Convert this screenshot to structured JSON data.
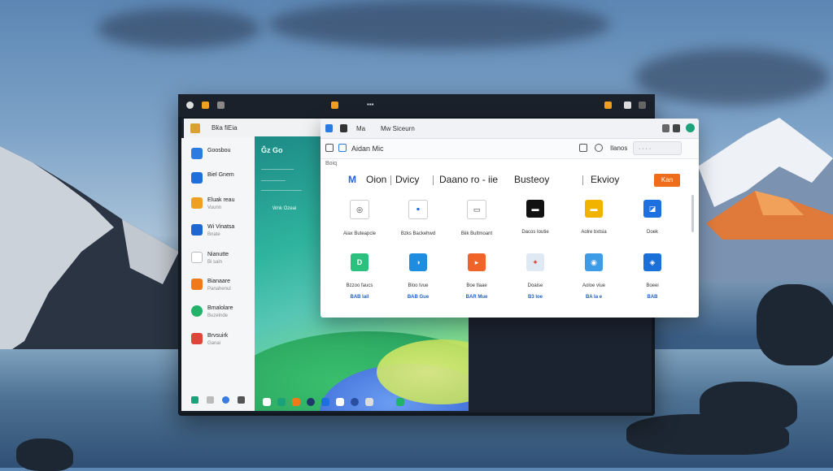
{
  "colors": {
    "accent": "#ef6c1a",
    "link_blue": "#1f5fbf",
    "window_bg": "#ffffff",
    "titlebar_bg": "#f1f2f5"
  },
  "monitor_bar": {
    "text": "▪▪▪"
  },
  "back_window": {
    "header_text": "Bk̈a fiEia"
  },
  "left_panel": {
    "items": [
      {
        "icon": "app-icon",
        "title": "Goosbou",
        "subtitle": ""
      },
      {
        "icon": "app-icon",
        "title": "Biel Gnem",
        "subtitle": ""
      },
      {
        "icon": "app-icon",
        "title": "Eluak reau",
        "subtitle": "Vuunn"
      },
      {
        "icon": "app-icon",
        "title": "Wi Vinatsa",
        "subtitle": "Bnate"
      },
      {
        "icon": "app-icon",
        "title": "Nianutte",
        "subtitle": "Bi sain"
      },
      {
        "icon": "app-icon",
        "title": "Bianaare",
        "subtitle": "Panahenul"
      },
      {
        "icon": "app-icon",
        "title": "Bmalolare",
        "subtitle": "Buzelnde"
      },
      {
        "icon": "app-icon",
        "title": "Brvsuirk",
        "subtitle": "Ganai"
      }
    ]
  },
  "green_panel": {
    "title": "Ĝz Go",
    "subtitle": "Wnk Ozeai"
  },
  "app_window": {
    "title_items": [
      "Ma",
      "Mw Siceurn"
    ],
    "toolbar_title": "Aidan Mic",
    "search_value": "Ilanos",
    "crumb": "Boiq",
    "heading_parts": [
      "Oion",
      "Dvicy",
      "Daano ro - iie",
      "Busteoy",
      "Ekvioy"
    ],
    "accent_button": "Kan",
    "apps_row1": [
      {
        "icon_name": "app-icon",
        "label": "Aiax Buteapcle",
        "glyph": "◎",
        "color": "#ffffff"
      },
      {
        "icon_name": "app-icon",
        "label": "Bzks Backehwd",
        "glyph": "ꔷ",
        "color": "#ffffff"
      },
      {
        "icon_name": "app-icon",
        "label": "Biik Bultmoant",
        "glyph": "▭",
        "color": "#ffffff"
      },
      {
        "icon_name": "app-icon",
        "label": "Dacos Ioutie",
        "glyph": "▬",
        "color": "#111111"
      },
      {
        "icon_name": "app-icon",
        "label": "Aolre bxtsia",
        "glyph": "▬",
        "color": "#f2b200"
      },
      {
        "icon_name": "app-icon",
        "label": "Doek",
        "glyph": "◪",
        "color": "#1e6fe0"
      }
    ],
    "apps_row2": [
      {
        "icon_name": "app-icon",
        "label": "Bzzoo faucs",
        "meta": "BAB lail",
        "glyph": "D",
        "color": "#2bc07d"
      },
      {
        "icon_name": "app-icon",
        "label": "Bloo  tvue",
        "meta": "BAB Gue",
        "glyph": "◑",
        "color": "#1e8de0"
      },
      {
        "icon_name": "app-icon",
        "label": "Boe tlaae",
        "meta": "BAR Mue",
        "glyph": "▸",
        "color": "#f0642a"
      },
      {
        "icon_name": "app-icon",
        "label": "Doaise",
        "meta": "B3 Ioe",
        "glyph": "✦",
        "color": "#dfe9f4"
      },
      {
        "icon_name": "app-icon",
        "label": "Aoloe  viue",
        "meta": "BA Ia e",
        "glyph": "◉",
        "color": "#3e9be6"
      },
      {
        "icon_name": "app-icon",
        "label": "Boeei",
        "meta": "BAB",
        "glyph": "◈",
        "color": "#1b6fd8"
      }
    ]
  }
}
